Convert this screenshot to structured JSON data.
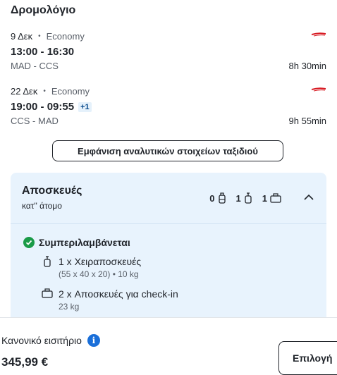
{
  "itinerary": {
    "title": "Δρομολόγιο",
    "flights": [
      {
        "date": "9 Δεκ",
        "cabin": "Economy",
        "times": "13:00 - 16:30",
        "day_offset": "",
        "route": "MAD - CCS",
        "duration": "8h 30min"
      },
      {
        "date": "22 Δεκ",
        "cabin": "Economy",
        "times": "19:00 - 09:55",
        "day_offset": "+1",
        "route": "CCS - MAD",
        "duration": "9h 55min"
      }
    ],
    "details_button": "Εμφάνιση αναλυτικών στοιχείων ταξιδιού"
  },
  "baggage": {
    "title": "Αποσκευές",
    "subtitle": "κατ\" άτομο",
    "counts": {
      "personal": "0",
      "cabin": "1",
      "checked": "1"
    },
    "included_label": "Συμπεριλαμβάνεται",
    "items": [
      {
        "label": "1 x Χειραποσκευές",
        "detail": "(55 x 40 x 20) • 10 kg"
      },
      {
        "label": "2 x Αποσκευές για check-in",
        "detail": "23 kg"
      }
    ]
  },
  "footer": {
    "fare_name": "Κανονικό εισιτήριο",
    "price": "345,99 €",
    "select_label": "Επιλογή"
  },
  "colors": {
    "accent": "#1a6fd9",
    "baggage_bg": "#e8f3fd",
    "included_green": "#1a9b48",
    "airline_red": "#d71921"
  }
}
